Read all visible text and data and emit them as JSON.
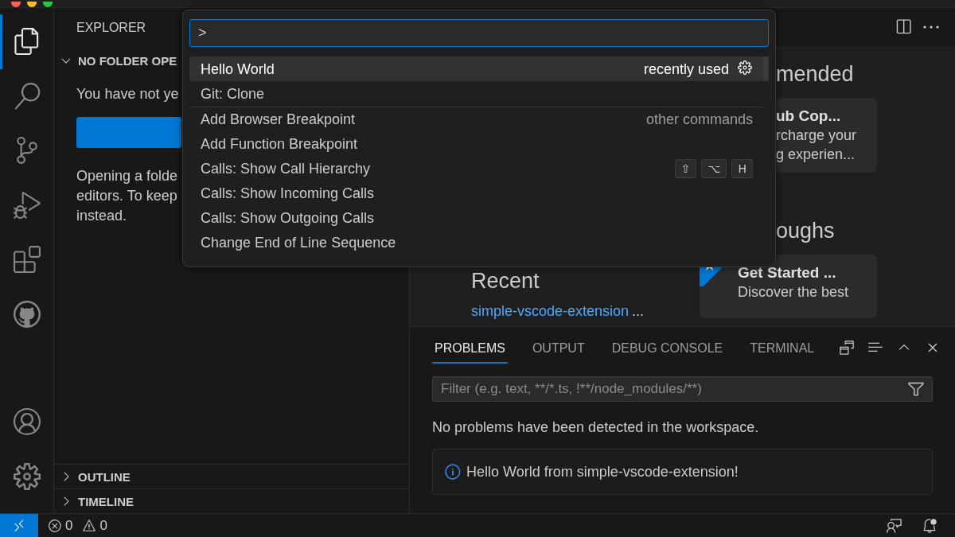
{
  "activity_bar": {
    "items": [
      {
        "kind": "files",
        "selected": true
      },
      {
        "kind": "search",
        "selected": false
      },
      {
        "kind": "source_control",
        "selected": false
      },
      {
        "kind": "debug",
        "selected": false
      },
      {
        "kind": "extensions",
        "selected": false
      },
      {
        "kind": "github",
        "selected": false
      }
    ],
    "bottom": [
      {
        "kind": "account"
      },
      {
        "kind": "settings"
      }
    ]
  },
  "sidebar": {
    "title": "EXPLORER",
    "section": {
      "title": "NO FOLDER OPE",
      "expanded": true
    },
    "message": "You have not ye",
    "paragraph": [
      "Opening a folde",
      "editors. To keep",
      "instead."
    ],
    "collapsed_sections": [
      {
        "title": "OUTLINE",
        "expanded": false
      },
      {
        "title": "TIMELINE",
        "expanded": false
      }
    ]
  },
  "command_palette": {
    "input": {
      "value": ">"
    },
    "items": [
      {
        "label": "Hello World",
        "selected": true,
        "detail": "recently used",
        "settings": true
      },
      {
        "label": "Git: Clone",
        "selected": false
      },
      {
        "label": "Add Browser Breakpoint",
        "selected": false,
        "detail": "other commands",
        "separator_before": true
      },
      {
        "label": "Add Function Breakpoint",
        "selected": false
      },
      {
        "label": "Calls: Show Call Hierarchy",
        "selected": false,
        "keys": [
          "⇧",
          "⌥",
          "H"
        ]
      },
      {
        "label": "Calls: Show Incoming Calls",
        "selected": false
      },
      {
        "label": "Calls: Show Outgoing Calls",
        "selected": false
      },
      {
        "label": "Change End of Line Sequence",
        "selected": false
      }
    ]
  },
  "editor": {
    "recommended": {
      "heading": "mended",
      "card": {
        "title": "ub Cop...",
        "lines": [
          "rcharge your",
          "g experien..."
        ]
      }
    },
    "walkthroughs": {
      "heading": "oughs",
      "card": {
        "title": "Get Started ...",
        "description": "Discover the best",
        "featured": true
      }
    },
    "recent": {
      "heading": "Recent",
      "items": [
        {
          "name": "simple-vscode-extension",
          "path": "..."
        }
      ]
    }
  },
  "panel": {
    "tabs": [
      {
        "label": "PROBLEMS",
        "selected": true
      },
      {
        "label": "OUTPUT",
        "selected": false
      },
      {
        "label": "DEBUG CONSOLE",
        "selected": false
      },
      {
        "label": "TERMINAL",
        "selected": false
      }
    ],
    "filter": {
      "placeholder": "Filter (e.g. text, **/*.ts, !**/node_modules/**)"
    },
    "message": "No problems have been detected in the workspace.",
    "notification": {
      "kind": "info",
      "text": "Hello World from simple-vscode-extension!"
    }
  },
  "status_bar": {
    "errors": "0",
    "warnings": "0"
  }
}
